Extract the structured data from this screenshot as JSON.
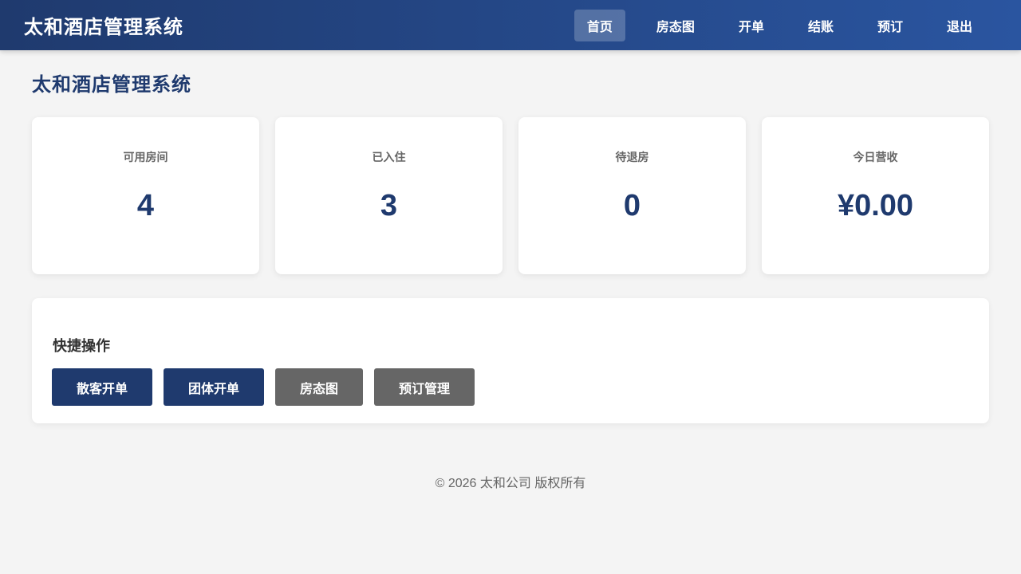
{
  "header": {
    "brand": "太和酒店管理系统",
    "nav": [
      {
        "label": "首页",
        "active": true
      },
      {
        "label": "房态图",
        "active": false
      },
      {
        "label": "开单",
        "active": false
      },
      {
        "label": "结账",
        "active": false
      },
      {
        "label": "预订",
        "active": false
      },
      {
        "label": "退出",
        "active": false
      }
    ]
  },
  "page_title": "太和酒店管理系统",
  "stats": [
    {
      "label": "可用房间",
      "value": "4"
    },
    {
      "label": "已入住",
      "value": "3"
    },
    {
      "label": "待退房",
      "value": "0"
    },
    {
      "label": "今日营收",
      "value": "¥0.00"
    }
  ],
  "quick_actions": {
    "title": "快捷操作",
    "buttons": [
      {
        "label": "散客开单"
      },
      {
        "label": "团体开单"
      },
      {
        "label": "房态图"
      },
      {
        "label": "预订管理"
      }
    ]
  },
  "footer": "© 2026 太和公司 版权所有",
  "colors": {
    "primary": "#1f3a6e",
    "secondary_button": "#666666",
    "background": "#f4f4f4"
  }
}
